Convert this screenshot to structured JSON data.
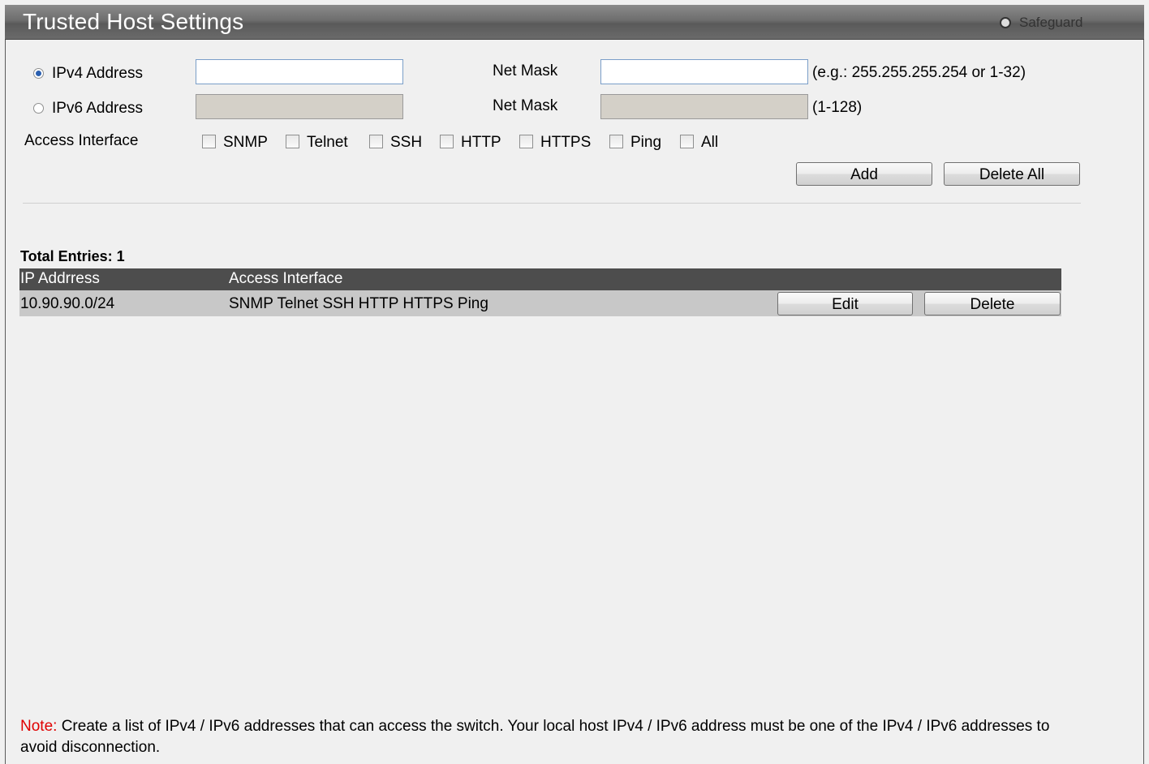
{
  "header": {
    "title": "Trusted Host Settings",
    "safeguard_label": "Safeguard"
  },
  "form": {
    "ipv4_label": "IPv4 Address",
    "ipv6_label": "IPv6 Address",
    "selected_address_type": "ipv4",
    "ipv4_value": "",
    "ipv6_value": "",
    "netmask_label_1": "Net Mask",
    "netmask_label_2": "Net Mask",
    "ipv4_netmask_value": "",
    "ipv6_netmask_value": "",
    "ipv4_netmask_hint": "(e.g.: 255.255.255.254 or 1-32)",
    "ipv6_netmask_hint": "(1-128)",
    "access_interface_label": "Access Interface",
    "interfaces": [
      {
        "label": "SNMP",
        "checked": false
      },
      {
        "label": "Telnet",
        "checked": false
      },
      {
        "label": "SSH",
        "checked": false
      },
      {
        "label": "HTTP",
        "checked": false
      },
      {
        "label": "HTTPS",
        "checked": false
      },
      {
        "label": "Ping",
        "checked": false
      },
      {
        "label": "All",
        "checked": false
      }
    ],
    "add_label": "Add",
    "delete_all_label": "Delete All"
  },
  "table": {
    "total_entries_label": "Total Entries: 1",
    "columns": [
      "IP Addrress",
      "Access Interface"
    ],
    "rows": [
      {
        "ip": "10.90.90.0/24",
        "access": "SNMP Telnet SSH HTTP HTTPS Ping",
        "edit_label": "Edit",
        "delete_label": "Delete"
      }
    ]
  },
  "note": {
    "label": "Note:",
    "text": " Create a list of IPv4 / IPv6 addresses that can access the switch. Your local host IPv4 / IPv6 address must be one of the IPv4 / IPv6 addresses to avoid disconnection."
  }
}
